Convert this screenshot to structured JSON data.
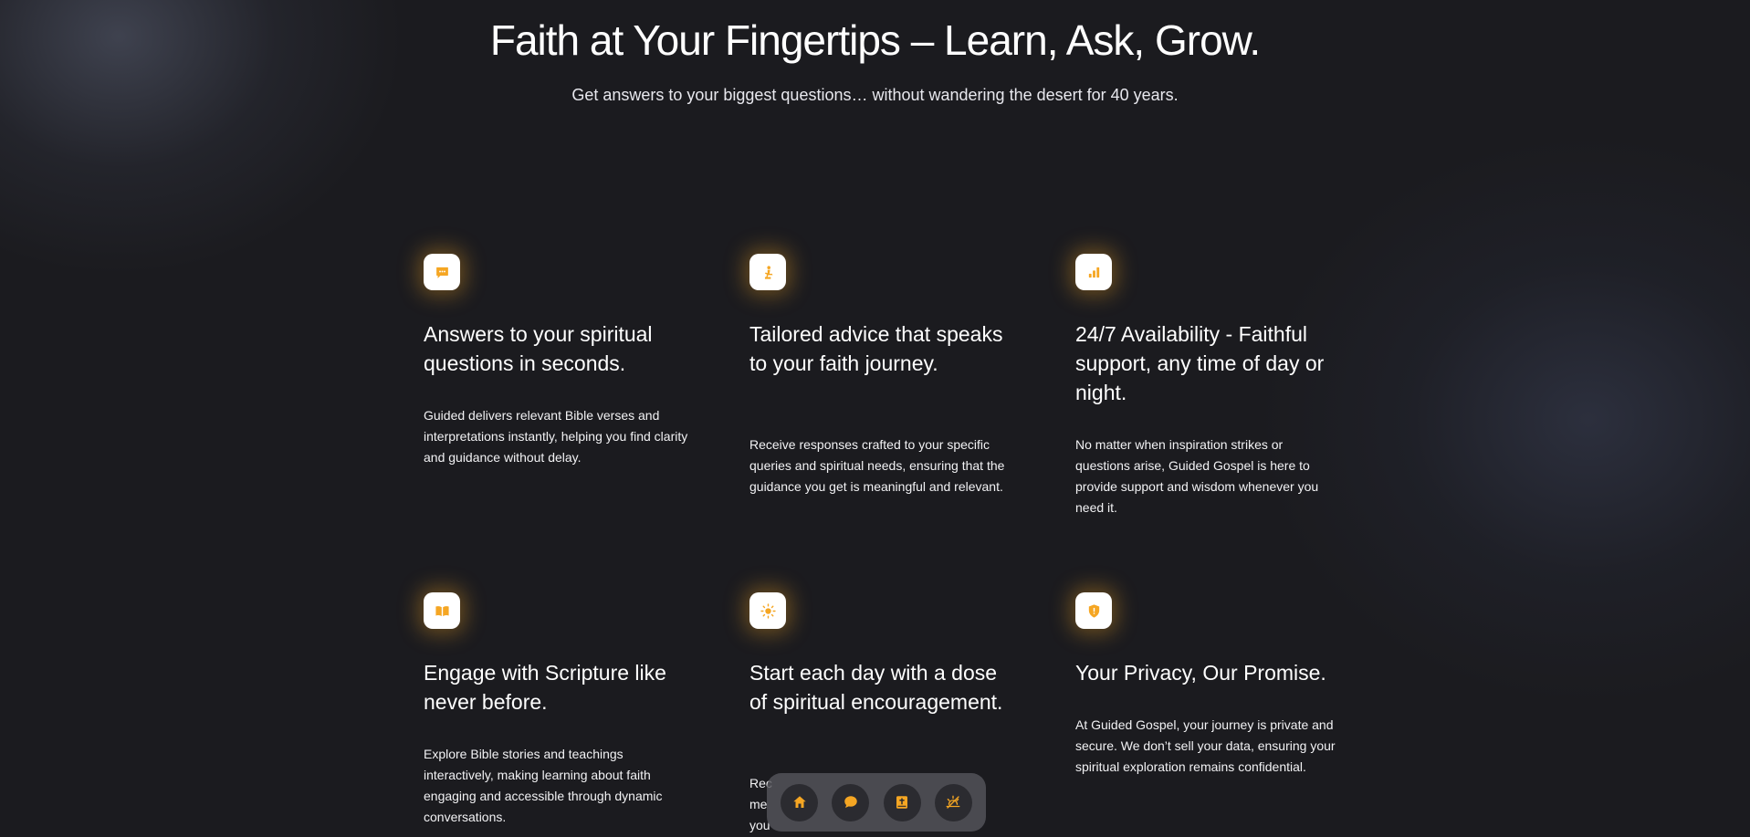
{
  "hero": {
    "title": "Faith at Your Fingertips – Learn, Ask, Grow.",
    "subtitle": "Get answers to your biggest questions… without wandering the desert for 40 years."
  },
  "colors": {
    "background": "#1b1b1f",
    "accent": "#f5a623",
    "icon_tile": "#ffffff"
  },
  "features": [
    {
      "icon": "chat-icon",
      "title": "Answers to your spiritual questions in seconds.",
      "description": "Guided delivers relevant Bible verses and interpretations instantly, helping you find clarity and guidance without delay."
    },
    {
      "icon": "praying-person-icon",
      "title": "Tailored advice that speaks to your faith journey.",
      "description": "Receive responses crafted to your specific queries and spiritual needs, ensuring that the guidance you get is meaningful and relevant."
    },
    {
      "icon": "signal-bars-icon",
      "title": "24/7 Availability - Faithful support, any time of day or night.",
      "description": "No matter when inspiration strikes or questions arise, Guided Gospel is here to provide support and wisdom whenever you need it."
    },
    {
      "icon": "open-book-icon",
      "title": "Engage with Scripture like never before.",
      "description": "Explore Bible stories and teachings interactively, making learning about faith engaging and accessible through dynamic conversations."
    },
    {
      "icon": "sun-icon",
      "title": "Start each day with a dose of spiritual encouragement.",
      "description": "Rec me you"
    },
    {
      "icon": "shield-icon",
      "title": "Your Privacy, Our Promise.",
      "description": "At Guided Gospel, your journey is private and secure. We don’t sell your data, ensuring your spiritual exploration remains confidential."
    }
  ],
  "dock": {
    "items": [
      {
        "icon": "home-icon"
      },
      {
        "icon": "chat-bubble-icon"
      },
      {
        "icon": "bible-icon"
      },
      {
        "icon": "sunrise-icon"
      }
    ]
  }
}
